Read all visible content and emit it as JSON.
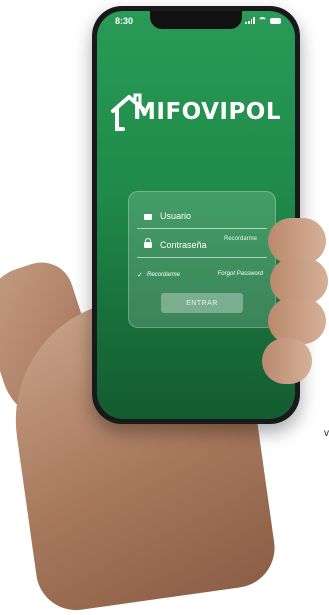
{
  "status_bar": {
    "time": "8:30",
    "icons": [
      "cellular-signal-icon",
      "wifi-icon",
      "battery-icon"
    ]
  },
  "app": {
    "logo_icon": "house-m-logo-icon",
    "logo_text": "MIFOVIPOL"
  },
  "login": {
    "username_placeholder": "Usuario",
    "password_placeholder": "Contraseña",
    "password_hint": "Recordarme",
    "remember_label": "Recordarme",
    "remember_check": "✓",
    "forgot_label": "Forgot Password",
    "submit_label": "ENTRAR"
  },
  "colors": {
    "screen_green": "#1f8a49",
    "card_overlay": "rgba(255,255,255,0.16)"
  },
  "decor": {
    "side_mark": "v"
  }
}
